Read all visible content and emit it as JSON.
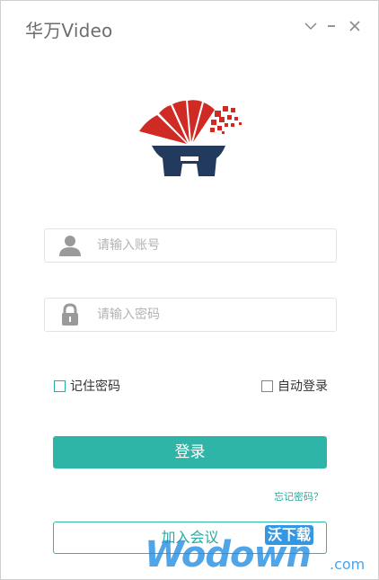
{
  "app": {
    "title": "华万Video"
  },
  "window_controls": {
    "collapse_symbol": "⌄",
    "minimize_symbol": "−",
    "close_symbol": "×"
  },
  "logo": {
    "icon": "huawan-logo",
    "colors": {
      "red": "#cf2b24",
      "navy": "#223a5e"
    }
  },
  "form": {
    "account": {
      "placeholder": "请输入账号",
      "value": "",
      "icon": "user-icon"
    },
    "password": {
      "placeholder": "请输入密码",
      "value": "",
      "icon": "lock-icon"
    },
    "remember_password_label": "记住密码",
    "auto_login_label": "自动登录",
    "login_label": "登录",
    "forgot_label": "忘记密码？",
    "join_label": "加入会议"
  },
  "watermark": {
    "text": "Wodown",
    "suffix": ".com",
    "badge": "沃下载"
  },
  "colors": {
    "accent": "#2fb5a7",
    "accent_text": "#2aab9f",
    "placeholder": "#b3b3b3",
    "watermark": "#1e8ce1"
  }
}
